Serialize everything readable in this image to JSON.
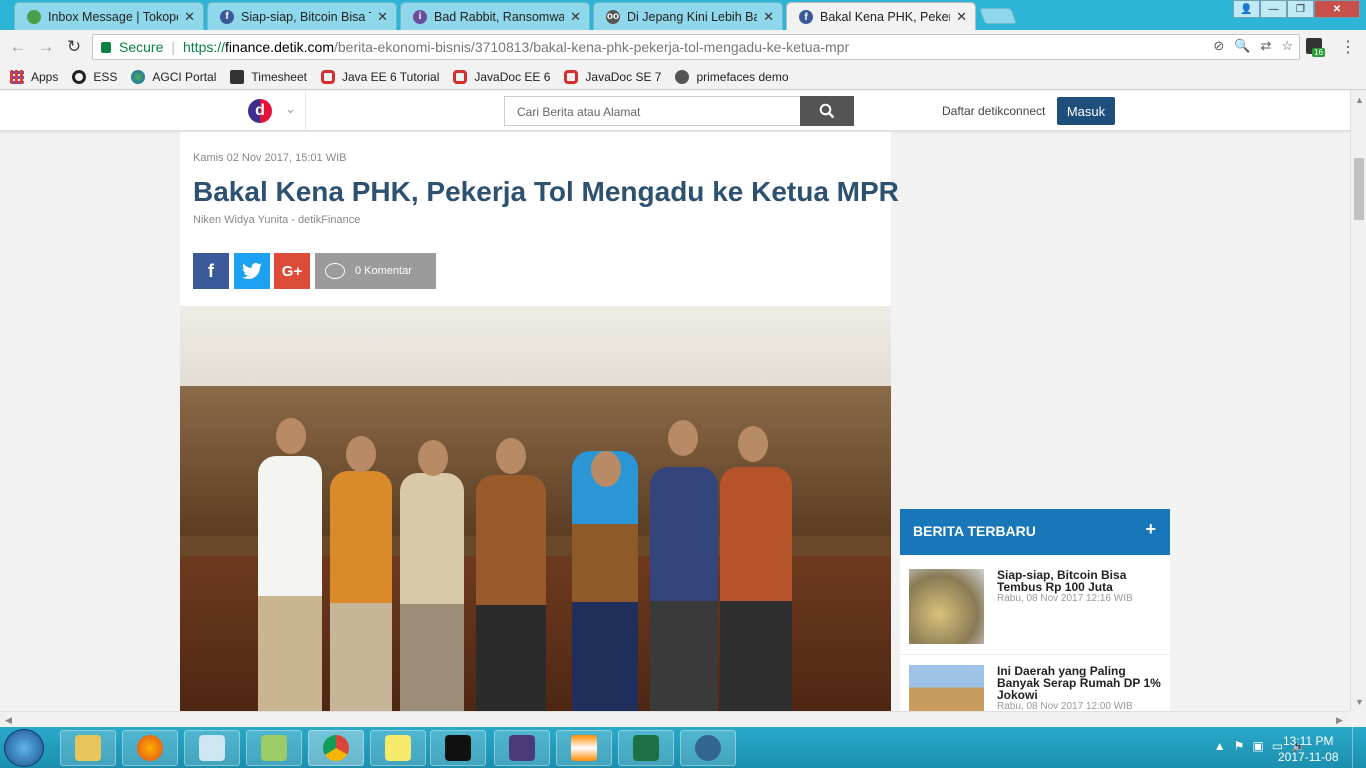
{
  "tabs": [
    {
      "title": "Inbox Message | Tokopedia",
      "icon": "mail-icon",
      "color": "#4a9e4a"
    },
    {
      "title": "Siap-siap, Bitcoin Bisa Tembus",
      "icon": "facebook-icon",
      "color": "#3b5998"
    },
    {
      "title": "Bad Rabbit, Ransomware",
      "icon": "info-icon",
      "color": "#6c4c9c"
    },
    {
      "title": "Di Jepang Kini Lebih Banyak",
      "icon": "glasses-icon",
      "color": "#555555"
    },
    {
      "title": "Bakal Kena PHK, Pekerja Tol",
      "icon": "facebook-icon",
      "color": "#3b5998"
    }
  ],
  "toolbar": {
    "secure_label": "Secure",
    "url_scheme": "https://",
    "url_host": "finance.detik.com",
    "url_path": "/berita-ekonomi-bisnis/3710813/bakal-kena-phk-pekerja-tol-mengadu-ke-ketua-mpr",
    "extension_badge": "16"
  },
  "bookmarks": [
    {
      "label": "Apps",
      "icon": "apps-grid-icon"
    },
    {
      "label": "ESS",
      "icon": "ess-icon"
    },
    {
      "label": "AGCI Portal",
      "icon": "agci-icon"
    },
    {
      "label": "Timesheet",
      "icon": "timesheet-icon"
    },
    {
      "label": "Java EE 6 Tutorial",
      "icon": "oracle-icon"
    },
    {
      "label": "JavaDoc EE 6",
      "icon": "oracle-icon"
    },
    {
      "label": "JavaDoc SE 7",
      "icon": "oracle-icon"
    },
    {
      "label": "primefaces demo",
      "icon": "primefaces-icon"
    }
  ],
  "site": {
    "logo_letter": "d",
    "search_placeholder": "Cari Berita atau Alamat",
    "register_label": "Daftar detikconnect",
    "login_label": "Masuk"
  },
  "article": {
    "date": "Kamis 02 Nov 2017, 15:01 WIB",
    "title": "Bakal Kena PHK, Pekerja Tol Mengadu ke Ketua MPR",
    "author": "Niken Widya Yunita - detikFinance",
    "comments_label": "0 Komentar",
    "share_facebook": "f",
    "share_twitter": "t",
    "share_google": "G+"
  },
  "latest_news": {
    "heading": "BERITA TERBARU",
    "plus": "+",
    "items": [
      {
        "title": "Siap-siap, Bitcoin Bisa Tembus Rp 100 Juta",
        "date": "Rabu, 08 Nov 2017 12:16 WIB"
      },
      {
        "title": "Ini Daerah yang Paling Banyak Serap Rumah DP 1% Jokowi",
        "date": "Rabu, 08 Nov 2017 12:00 WIB"
      }
    ]
  },
  "taskbar": {
    "time": "13:11 PM",
    "date": "2017-11-08"
  },
  "colors": {
    "chrome_tabstrip": "#2cb5d6",
    "detik_title": "#2d5271",
    "news_header": "#1877b8",
    "login_button": "#1e4f7a",
    "facebook": "#3b5998",
    "twitter": "#1da1f2",
    "google": "#dd4b39"
  }
}
